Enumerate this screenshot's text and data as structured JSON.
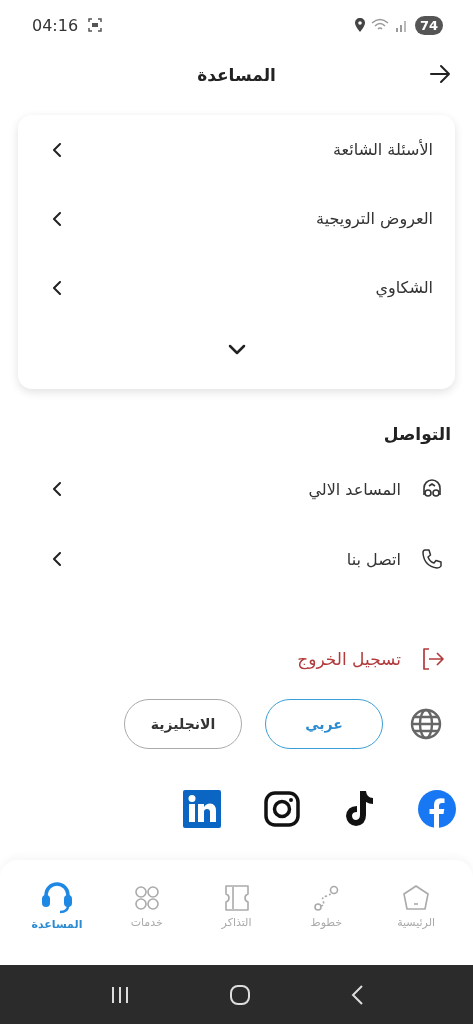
{
  "status_bar": {
    "time": "04:16",
    "battery": "74"
  },
  "header": {
    "title": "المساعدة"
  },
  "help_menu": {
    "expanded": false,
    "items": [
      {
        "label": "الأسئلة الشائعة"
      },
      {
        "label": "العروض الترويجية"
      },
      {
        "label": "الشكاوي"
      }
    ]
  },
  "contact": {
    "title": "التواصل",
    "items": [
      {
        "label": "المساعد الالي",
        "kind": "bot"
      },
      {
        "label": "اتصل بنا",
        "kind": "phone"
      }
    ]
  },
  "logout": {
    "label": "تسجيل الخروج"
  },
  "language": {
    "options": [
      {
        "label": "عربي",
        "selected": true
      },
      {
        "label": "الانجليزية",
        "selected": false
      }
    ]
  },
  "social": [
    {
      "kind": "facebook"
    },
    {
      "kind": "tiktok"
    },
    {
      "kind": "instagram"
    },
    {
      "kind": "linkedin"
    }
  ],
  "bottom_nav": [
    {
      "label": "الرئيسية",
      "kind": "home",
      "selected": false
    },
    {
      "label": "خطوط",
      "kind": "routes",
      "selected": false
    },
    {
      "label": "التذاكر",
      "kind": "tickets",
      "selected": false
    },
    {
      "label": "خدمات",
      "kind": "services",
      "selected": false
    },
    {
      "label": "المساعدة",
      "kind": "help",
      "selected": true
    }
  ]
}
